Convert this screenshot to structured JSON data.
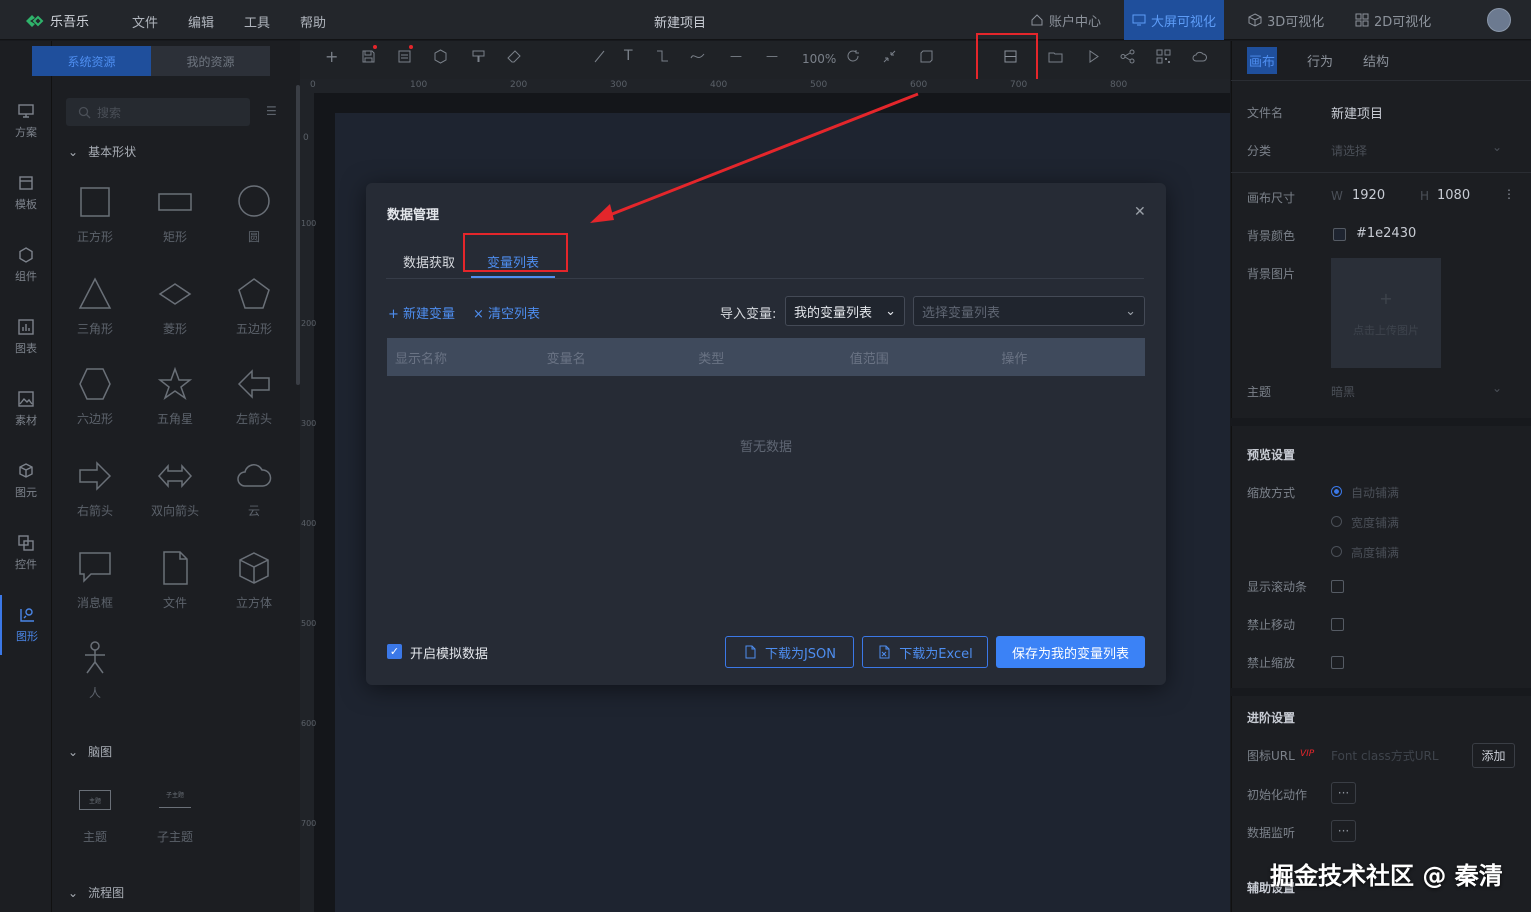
{
  "app": {
    "name": "乐吾乐",
    "project_title": "新建项目"
  },
  "menu": [
    "文件",
    "编辑",
    "工具",
    "帮助"
  ],
  "topnav": {
    "account": "账户中心",
    "bigscreen": "大屏可视化",
    "vis3d": "3D可视化",
    "vis2d": "2D可视化"
  },
  "leftnav": [
    "方案",
    "模板",
    "组件",
    "图表",
    "素材",
    "图元",
    "控件",
    "图形"
  ],
  "library": {
    "tabs": [
      "系统资源",
      "我的资源"
    ],
    "search_placeholder": "搜索",
    "sections": [
      "基本形状",
      "脑图",
      "流程图"
    ],
    "shapes": [
      "正方形",
      "矩形",
      "圆",
      "三角形",
      "菱形",
      "五边形",
      "六边形",
      "五角星",
      "左箭头",
      "右箭头",
      "双向箭头",
      "云",
      "消息框",
      "文件",
      "立方体",
      "人"
    ],
    "mind": [
      "主题",
      "子主题"
    ],
    "mind_glyphs": [
      "主题",
      "子主题"
    ]
  },
  "toolbar": {
    "zoom": "100%"
  },
  "ruler_x": [
    "0",
    "100",
    "200",
    "300",
    "400",
    "500",
    "600",
    "700",
    "800"
  ],
  "ruler_y": [
    "0",
    "100",
    "200",
    "300",
    "400",
    "500",
    "600",
    "700"
  ],
  "dialog": {
    "title": "数据管理",
    "tabs": [
      "数据获取",
      "变量列表"
    ],
    "new_var": "+ 新建变量",
    "clear_list": "× 清空列表",
    "import_label": "导入变量:",
    "my_list": "我的变量列表",
    "select_placeholder": "选择变量列表",
    "columns": [
      "显示名称",
      "变量名",
      "类型",
      "值范围",
      "操作"
    ],
    "empty": "暂无数据",
    "mock_label": "开启模拟数据",
    "mock_checked": true,
    "btn_json": "下载为JSON",
    "btn_excel": "下载为Excel",
    "btn_save": "保存为我的变量列表"
  },
  "right": {
    "tabs": [
      "画布",
      "行为",
      "结构"
    ],
    "filename_label": "文件名",
    "filename": "新建项目",
    "category_label": "分类",
    "category_placeholder": "请选择",
    "size_label": "画布尺寸",
    "w_label": "W",
    "width": "1920",
    "h_label": "H",
    "height": "1080",
    "bgcolor_label": "背景颜色",
    "bgcolor": "#1e2430",
    "bgimage_label": "背景图片",
    "upload_plus": "+",
    "upload_hint": "点击上传图片",
    "theme_label": "主题",
    "theme_placeholder": "暗黑",
    "preview_heading": "预览设置",
    "scale_label": "缩放方式",
    "scale_options": [
      "自动铺满",
      "宽度铺满",
      "高度铺满"
    ],
    "scrollbar_label": "显示滚动条",
    "nomove_label": "禁止移动",
    "nozoom_label": "禁止缩放",
    "advanced_heading": "进阶设置",
    "iconurl_label": "图标URL",
    "vip": "VIP",
    "iconurl_placeholder": "Font class方式URL",
    "add_button": "添加",
    "init_label": "初始化动作",
    "monitor_label": "数据监听",
    "aux_heading": "辅助设置",
    "dots": "···"
  },
  "watermark": "掘金技术社区 @ 秦清",
  "colors": {
    "accent": "#3b78e7",
    "highlight": "#e4262b",
    "canvas": "#1e2430"
  }
}
